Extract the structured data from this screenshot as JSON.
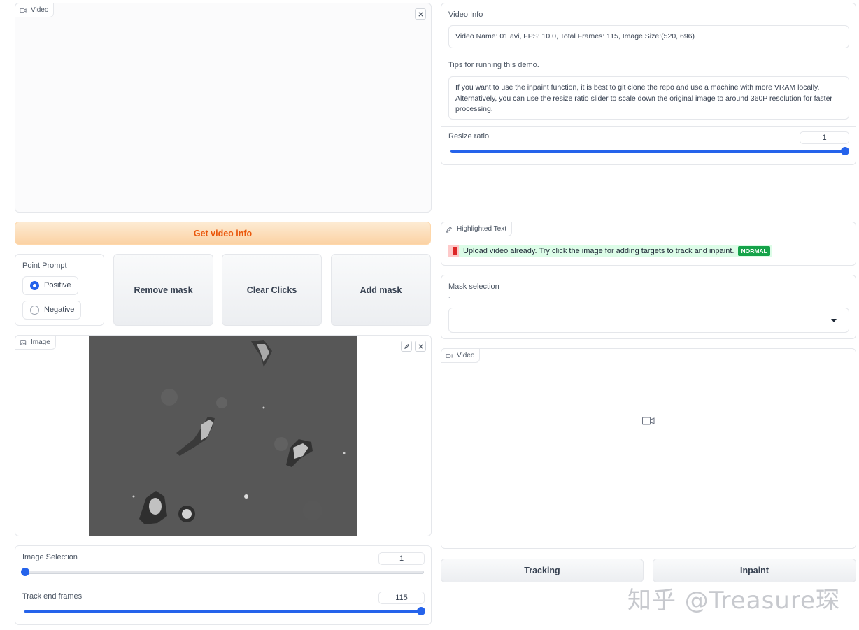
{
  "left": {
    "video_label": "Video",
    "get_info_label": "Get video info",
    "point_prompt": {
      "label": "Point Prompt",
      "options": [
        "Positive",
        "Negative"
      ],
      "selected": "Positive"
    },
    "remove_mask_label": "Remove mask",
    "clear_clicks_label": "Clear Clicks",
    "add_mask_label": "Add mask",
    "image_label": "Image",
    "image_selection": {
      "label": "Image Selection",
      "value": "1",
      "fraction": 0.0
    },
    "track_end": {
      "label": "Track end frames",
      "value": "115",
      "fraction": 1.0
    }
  },
  "right": {
    "video_info": {
      "label": "Video Info",
      "text": "Video Name: 01.avi, FPS: 10.0, Total Frames: 115, Image Size:(520, 696)"
    },
    "tips": {
      "label": "Tips for running this demo.",
      "text": "If you want to use the inpaint function, it is best to git clone the repo and use a machine with more VRAM locally. Alternatively, you can use the resize ratio slider to scale down the original image to around 360P resolution for faster processing."
    },
    "resize": {
      "label": "Resize ratio",
      "value": "1",
      "fraction": 1.0
    },
    "highlighted": {
      "label": "Highlighted Text",
      "message": "Upload video already. Try click the image for adding targets to track and inpaint.",
      "badge": "NORMAL"
    },
    "mask_selection": {
      "label": "Mask selection",
      "hint": "."
    },
    "output_video_label": "Video",
    "tracking_label": "Tracking",
    "inpaint_label": "Inpaint"
  },
  "watermark": "知乎 @Treasure琛",
  "colors": {
    "accent": "#2563eb",
    "orange": "#ea580c",
    "badge": "#16a34a"
  }
}
